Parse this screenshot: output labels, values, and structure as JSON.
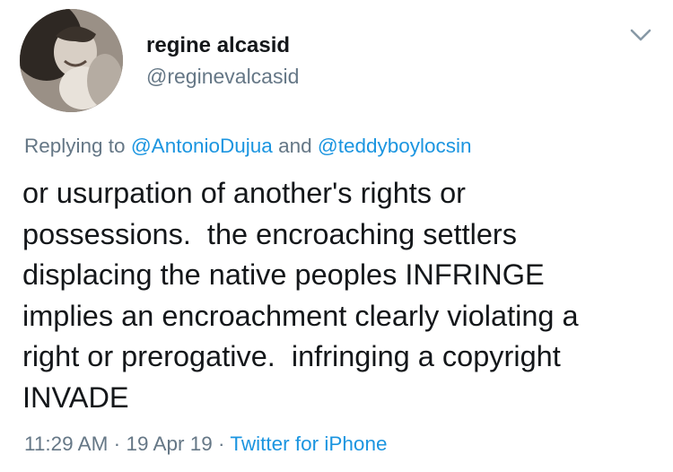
{
  "author": {
    "name": "regine alcasid",
    "handle": "@reginevalcasid"
  },
  "reply_context": {
    "prefix": "Replying to",
    "user1": "@AntonioDujua",
    "conjunction": "and",
    "user2": "@teddyboylocsin"
  },
  "tweet": {
    "lines": [
      "or usurpation of another's rights or",
      "possessions.  the encroaching settlers",
      "displacing the native peoples INFRINGE",
      "implies an encroachment clearly violating a",
      "right or prerogative.  infringing a copyright",
      "INVADE"
    ]
  },
  "meta": {
    "time": "11:29 AM",
    "separator1": "·",
    "date": "19 Apr 19",
    "separator2": "·",
    "source": "Twitter for iPhone"
  },
  "colors": {
    "text": "#14171a",
    "secondary": "#657786",
    "link": "#1b95e0",
    "background": "#ffffff"
  },
  "icons": {
    "menu": "chevron-down-icon",
    "avatar": "profile-photo"
  }
}
